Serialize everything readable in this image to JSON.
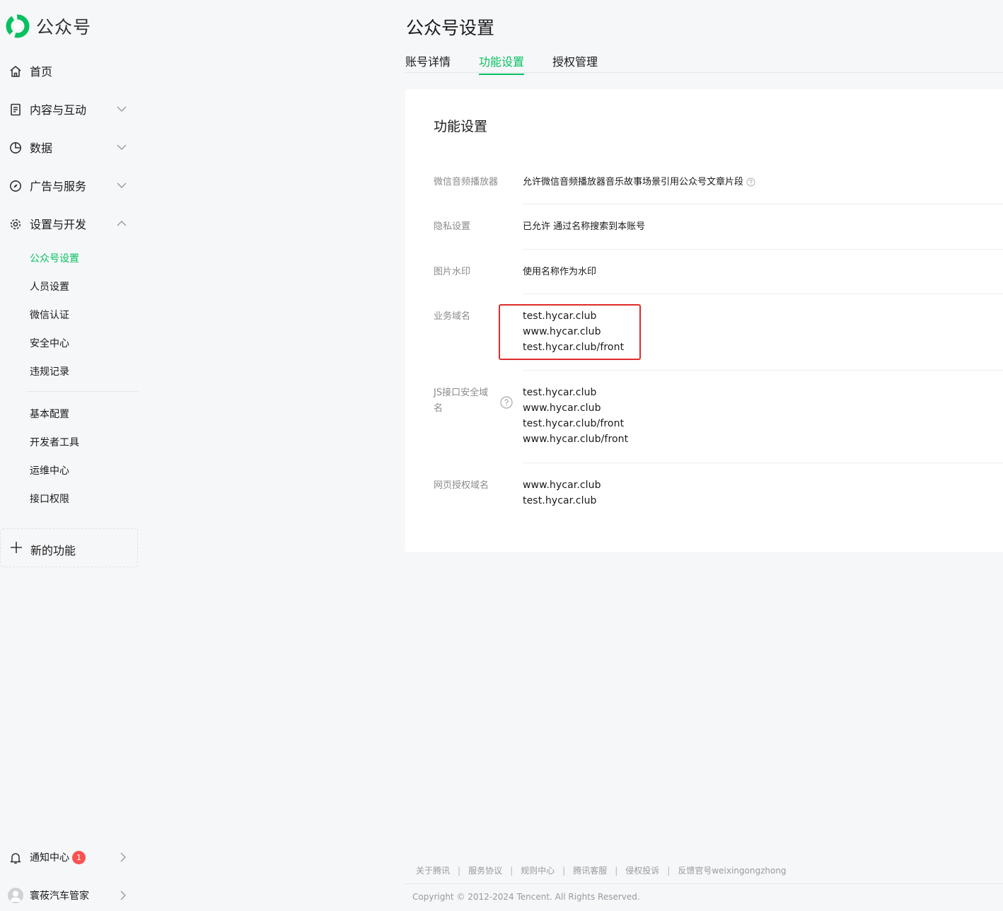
{
  "app": {
    "logo_text": "公众号"
  },
  "sidebar": {
    "nav": [
      {
        "label": "首页"
      },
      {
        "label": "内容与互动"
      },
      {
        "label": "数据"
      },
      {
        "label": "广告与服务"
      },
      {
        "label": "设置与开发"
      }
    ],
    "sub_items_group1": [
      "公众号设置",
      "人员设置",
      "微信认证",
      "安全中心",
      "违规记录"
    ],
    "sub_items_group2": [
      "基本配置",
      "开发者工具",
      "运维中心",
      "接口权限"
    ],
    "new_feature_label": "新的功能",
    "notification": {
      "label": "通知中心",
      "count": "1"
    },
    "account_name": "寰莜汽车管家"
  },
  "header": {
    "title": "公众号设置",
    "tabs": [
      "账号详情",
      "功能设置",
      "授权管理"
    ],
    "active_tab": "功能设置"
  },
  "card": {
    "title": "功能设置",
    "rows": [
      {
        "label": "微信音频播放器",
        "values": [
          "允许微信音频播放器音乐故事场景引用公众号文章片段"
        ]
      },
      {
        "label": "隐私设置",
        "values": [
          "已允许 通过名称搜索到本账号"
        ]
      },
      {
        "label": "图片水印",
        "values": [
          "使用名称作为水印"
        ]
      },
      {
        "label": "业务域名",
        "values": [
          "test.hycar.club",
          "www.hycar.club",
          "test.hycar.club/front"
        ]
      },
      {
        "label_line1": "JS接口安全域",
        "label_line2": "名",
        "values": [
          "test.hycar.club",
          "www.hycar.club",
          "test.hycar.club/front",
          "www.hycar.club/front"
        ]
      },
      {
        "label": "网页授权域名",
        "values": [
          "www.hycar.club",
          "test.hycar.club"
        ]
      }
    ]
  },
  "footer": {
    "links": [
      "关于腾讯",
      "服务协议",
      "规则中心",
      "腾讯客服",
      "侵权投诉",
      "反馈官号weixingongzhong"
    ],
    "copyright": "Copyright © 2012-2024 Tencent. All Rights Reserved."
  },
  "colors": {
    "accent": "#07c160",
    "highlight_box": "#e02b2b",
    "badge": "#fa5151"
  },
  "icons": [
    "wechat-mp-logo-icon",
    "home-icon",
    "document-icon",
    "pie-chart-icon",
    "compass-icon",
    "gear-icon",
    "chevron-down-icon",
    "chevron-up-icon",
    "plus-icon",
    "bell-icon",
    "chevron-right-icon",
    "question-circle-icon"
  ]
}
